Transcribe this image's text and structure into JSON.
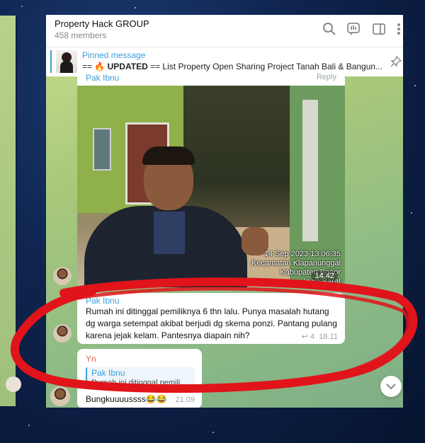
{
  "header": {
    "group_name": "Property Hack GROUP",
    "member_count": "458 members",
    "icons": [
      "search-icon",
      "poll-icon",
      "sidebar-icon",
      "more-vertical-icon"
    ]
  },
  "pinned": {
    "label": "Pinned message",
    "prefix": "== 🔥 ",
    "bold": "UPDATED",
    "text": " ==  List Property Open Sharing Project  Tanah Bali & Bangun..."
  },
  "photo_message": {
    "sender": "Pak Ibnu",
    "reply_label": "Reply",
    "stamp_lines": [
      "14 Sep 2023 13.06.35",
      "Kecamatan Klapanunggal",
      "Kabupaten Bogor",
      "Jawa Barat"
    ],
    "time": "14.42"
  },
  "text_message": {
    "sender": "Pak Ibnu",
    "body": "Rumah ini ditinggal pemiliknya 6 thn lalu. Punya masalah hutang dg warga setempat akibat berjudi dg skema ponzi. Pantang pulang karena jejak kelam. Pantesnya diapain nih?",
    "replies_count": "4",
    "time": "18.11"
  },
  "reply_message": {
    "sender": "Yn",
    "quote_sender": "Pak Ibnu",
    "quote_text": "Rumah ini ditinggal pemili...",
    "body": "Bungkuuuussss😂😂",
    "time": "21.09"
  },
  "colors": {
    "accent": "#3a9fd8",
    "annotation": "#e0141a",
    "chat_bg": "#a9c87a"
  }
}
